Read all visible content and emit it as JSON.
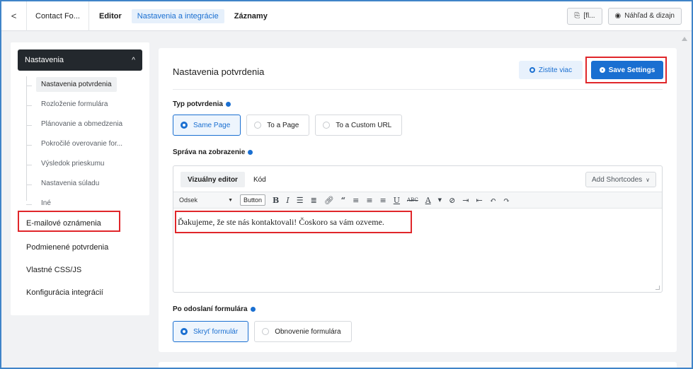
{
  "topbar": {
    "back_label": "<",
    "form_name": "Contact Fo...",
    "tabs": [
      {
        "label": "Editor"
      },
      {
        "label": "Nastavenia a integrácie"
      },
      {
        "label": "Záznamy"
      }
    ],
    "shortcode_button": "[fl...",
    "preview_button": "Náhľad & dizajn"
  },
  "sidebar": {
    "head_label": "Nastavenia",
    "chevron": "^",
    "sub_items": [
      {
        "label": "Nastavenia potvrdenia"
      },
      {
        "label": "Rozloženie formulára"
      },
      {
        "label": "Plánovanie a obmedzenia"
      },
      {
        "label": "Pokročilé overovanie for..."
      },
      {
        "label": "Výsledok prieskumu"
      },
      {
        "label": "Nastavenia súladu"
      },
      {
        "label": "Iné"
      }
    ],
    "links": [
      {
        "label": "E-mailové oznámenia"
      },
      {
        "label": "Podmienené potvrdenia"
      },
      {
        "label": "Vlastné CSS/JS"
      },
      {
        "label": "Konfigurácia integrácií"
      }
    ]
  },
  "main": {
    "title": "Nastavenia potvrdenia",
    "learn_more": "Zistite viac",
    "save": "Save Settings",
    "confirmation_type_label": "Typ potvrdenia",
    "confirmation_types": [
      {
        "label": "Same Page"
      },
      {
        "label": "To a Page"
      },
      {
        "label": "To a Custom URL"
      }
    ],
    "message_label": "Správa na zobrazenie",
    "editor": {
      "tab_visual": "Vizuálny editor",
      "tab_code": "Kód",
      "add_shortcodes": "Add Shortcodes",
      "format_select": "Odsek",
      "button_label": "Button",
      "content": "Ďakujeme, že ste nás kontaktovali! Čoskoro sa vám ozveme."
    },
    "after_submit_label": "Po odoslaní formulára",
    "after_submit_options": [
      {
        "label": "Skryť formulár"
      },
      {
        "label": "Obnovenie formulára"
      }
    ]
  },
  "colors": {
    "accent": "#1a6fd1",
    "highlight": "#e0262a",
    "sidebar_head": "#23282d"
  }
}
